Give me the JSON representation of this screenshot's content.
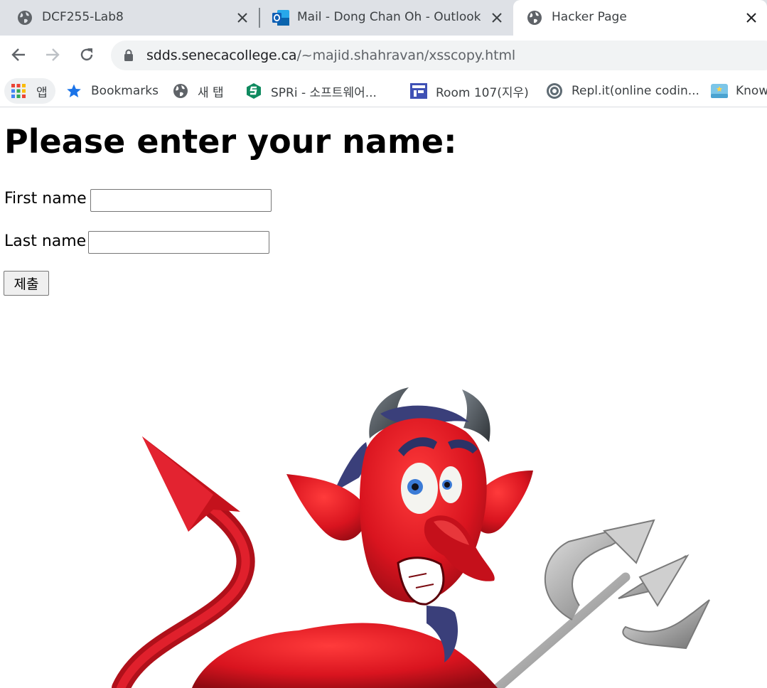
{
  "browser": {
    "tabs": [
      {
        "title": "DCF255-Lab8",
        "icon": "globe-icon"
      },
      {
        "title": "Mail - Dong Chan Oh - Outlook",
        "icon": "outlook-icon"
      },
      {
        "title": "Hacker Page",
        "icon": "globe-icon",
        "active": true
      }
    ],
    "url_host": "sdds.senecacollege.ca",
    "url_path": "/~majid.shahravan/xsscopy.html",
    "bookmarks": [
      {
        "label": "앱",
        "icon": "apps-grid-icon"
      },
      {
        "label": "Bookmarks",
        "icon": "star-icon"
      },
      {
        "label": "새 탭",
        "icon": "globe-icon"
      },
      {
        "label": "SPRi - 소프트웨어...",
        "icon": "spri-logo-icon"
      },
      {
        "label": "Room 107(지우)",
        "icon": "room-icon"
      },
      {
        "label": "Repl.it(online codin...",
        "icon": "replit-icon"
      },
      {
        "label": "Know",
        "icon": "book-icon"
      }
    ]
  },
  "page": {
    "heading": "Please enter your name:",
    "first_name_label": "First name",
    "first_name_value": "",
    "last_name_label": "Last name",
    "last_name_value": "",
    "submit_label": "제출",
    "image": "devil-illustration"
  },
  "colors": {
    "tabstrip": "#dee1e6",
    "devil_red": "#d9141f",
    "trident_gray": "#a9a9a9"
  }
}
